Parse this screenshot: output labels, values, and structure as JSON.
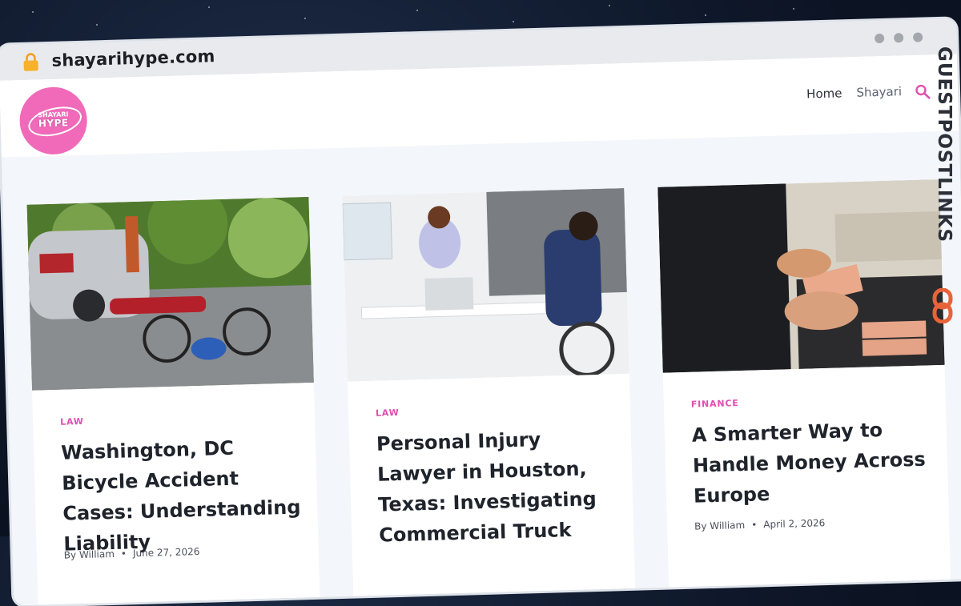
{
  "browser": {
    "url": "shayarihype.com",
    "icons": {
      "lock": "lock-icon",
      "window_controls": "dots"
    }
  },
  "site": {
    "logo": {
      "line1": "SHAYARI",
      "line2": "HYPE"
    },
    "nav": [
      {
        "label": "Home"
      },
      {
        "label": "Shayari"
      }
    ],
    "search_icon": "search-icon"
  },
  "posts": [
    {
      "category": "LAW",
      "title": "Washington, DC Bicycle Accident Cases: Understanding Liability",
      "author": "By William",
      "date": "June 27, 2026",
      "image": "cyclist-accident"
    },
    {
      "category": "LAW",
      "title": "Personal Injury Lawyer in Houston, Texas: Investigating Commercial Truck",
      "author": "",
      "date": "",
      "image": "lawyer-office"
    },
    {
      "category": "FINANCE",
      "title": "A Smarter Way to Handle Money Across Europe",
      "author": "By William",
      "date": "April 2, 2026",
      "image": "euro-cash-register"
    }
  ],
  "watermark": {
    "text": "GUESTPOSTLINKS"
  },
  "colors": {
    "accent": "#e04fb0",
    "logo_bg": "#f06ab9",
    "page_bg": "#f3f6fa",
    "brand_orange": "#e8633a"
  }
}
